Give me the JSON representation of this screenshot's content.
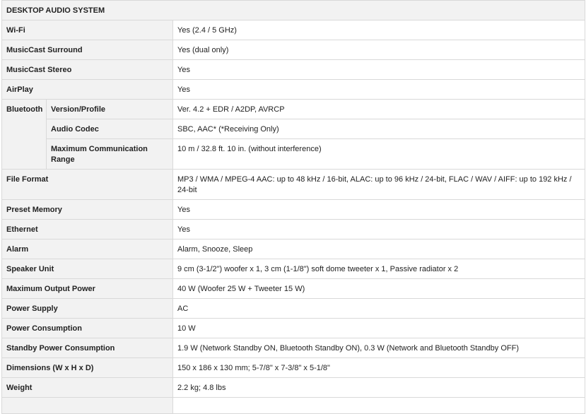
{
  "table": {
    "title": "DESKTOP AUDIO SYSTEM",
    "rows": {
      "wifi": {
        "label": "Wi-Fi",
        "value": "Yes (2.4 / 5 GHz)"
      },
      "surround": {
        "label": "MusicCast Surround",
        "value": "Yes (dual only)"
      },
      "stereo": {
        "label": "MusicCast Stereo",
        "value": "Yes"
      },
      "airplay": {
        "label": "AirPlay",
        "value": "Yes"
      },
      "bluetooth": {
        "label": "Bluetooth",
        "version": {
          "label": "Version/Profile",
          "value": "Ver. 4.2 + EDR / A2DP, AVRCP"
        },
        "codec": {
          "label": "Audio Codec",
          "value": "SBC, AAC* (*Receiving Only)"
        },
        "range": {
          "label": "Maximum Communication Range",
          "value": "10 m / 32.8 ft. 10 in. (without interference)"
        }
      },
      "file_format": {
        "label": "File Format",
        "value": "MP3 / WMA / MPEG-4 AAC: up to 48 kHz / 16-bit, ALAC: up to 96 kHz / 24-bit, FLAC / WAV / AIFF: up to 192 kHz / 24-bit"
      },
      "preset": {
        "label": "Preset Memory",
        "value": "Yes"
      },
      "ethernet": {
        "label": "Ethernet",
        "value": "Yes"
      },
      "alarm": {
        "label": "Alarm",
        "value": "Alarm, Snooze, Sleep"
      },
      "speaker": {
        "label": "Speaker Unit",
        "value": "9 cm (3-1/2\") woofer x 1, 3 cm (1-1/8\") soft dome tweeter x 1, Passive radiator x 2"
      },
      "output": {
        "label": "Maximum Output Power",
        "value": "40 W (Woofer 25 W + Tweeter 15 W)"
      },
      "supply": {
        "label": "Power Supply",
        "value": "AC"
      },
      "consumption": {
        "label": "Power Consumption",
        "value": "10 W"
      },
      "standby": {
        "label": "Standby Power Consumption",
        "value": "1.9 W (Network Standby ON, Bluetooth Standby ON), 0.3 W (Network and Bluetooth Standby OFF)"
      },
      "dimensions": {
        "label": "Dimensions (W x H x D)",
        "value": "150 x 186 x 130 mm; 5-7/8\" x 7-3/8\" x 5-1/8\""
      },
      "weight": {
        "label": "Weight",
        "value": "2.2 kg; 4.8 lbs"
      }
    }
  }
}
